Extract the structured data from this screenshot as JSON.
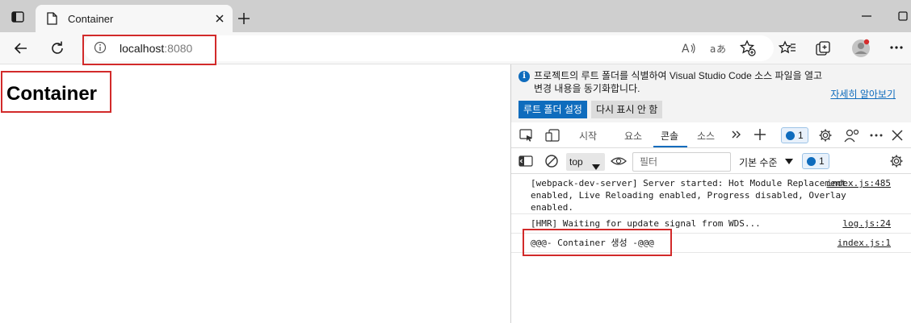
{
  "browser": {
    "tab": {
      "title": "Container"
    },
    "address": {
      "host": "localhost",
      "port": ":8080"
    },
    "colors": {
      "tabstrip": "#cfcfcf",
      "toolbar": "#f7f7f7",
      "highlight": "#d22a2a"
    }
  },
  "page": {
    "heading": "Container"
  },
  "devtools": {
    "infobar": {
      "message": "프로젝트의 루트 폴더를 식별하여 Visual Studio Code 소스 파일을 열고 변경 내용을 동기화합니다.",
      "link": "자세히 알아보기",
      "primary_button": "루트 폴더 설정",
      "secondary_button": "다시 표시 안 함"
    },
    "tabs": [
      {
        "label": "시작"
      },
      {
        "label": "요소"
      },
      {
        "label": "콘솔"
      },
      {
        "label": "소스"
      }
    ],
    "issues_count": "1",
    "console": {
      "context": "top",
      "filter_placeholder": "필터",
      "level": "기본 수준",
      "issues_count": "1",
      "messages": [
        {
          "text": "[webpack-dev-server] Server started: Hot Module Replacement enabled, Live Reloading enabled, Progress disabled, Overlay enabled.",
          "source": "index.js:485"
        },
        {
          "text": "[HMR] Waiting for update signal from WDS...",
          "source": "log.js:24"
        },
        {
          "text": "@@@- Container 생성 -@@@",
          "source": "index.js:1"
        }
      ]
    }
  }
}
